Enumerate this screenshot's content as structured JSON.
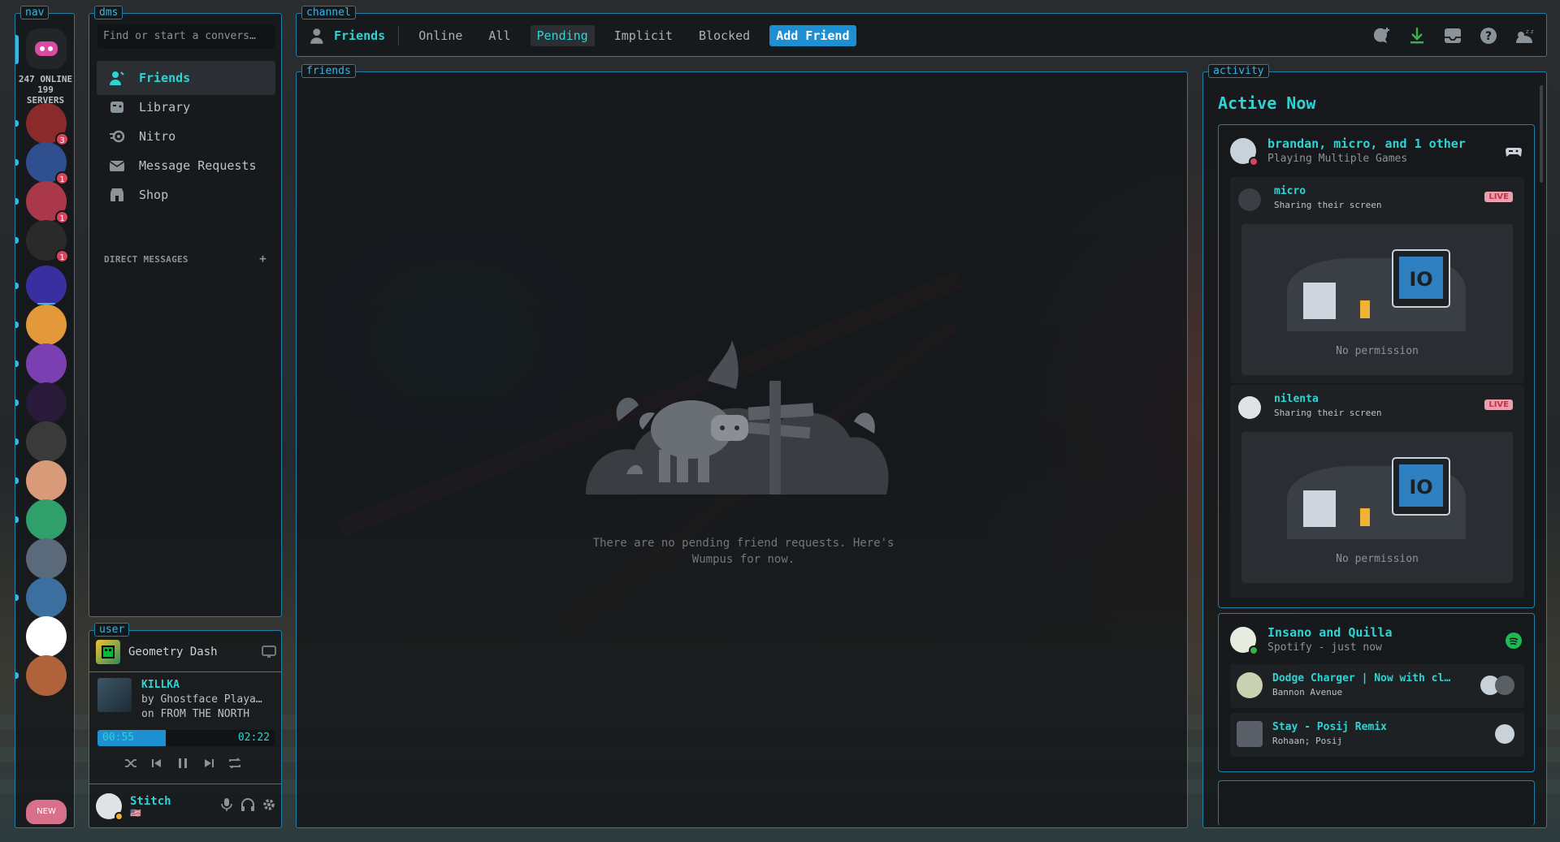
{
  "panels": {
    "nav": "nav",
    "dms": "dms",
    "user": "user",
    "channel": "channel",
    "friends": "friends",
    "activity": "activity"
  },
  "nav": {
    "online_stats": "247 ONLINE\n199\nSERVERS",
    "servers": [
      {
        "badge": "3"
      },
      {
        "badge": "1"
      },
      {
        "badge": "1"
      },
      {
        "badge": "1"
      },
      {
        "badge": ""
      },
      {
        "badge": ""
      },
      {
        "badge": ""
      },
      {
        "badge": ""
      },
      {
        "badge": ""
      },
      {
        "badge": ""
      },
      {
        "badge": ""
      },
      {
        "badge": ""
      },
      {
        "badge": ""
      },
      {
        "badge": ""
      },
      {
        "badge": ""
      }
    ],
    "new_label": "NEW"
  },
  "dms": {
    "search_placeholder": "Find or start a convers…",
    "items": [
      {
        "label": "Friends",
        "icon": "person-wave-icon"
      },
      {
        "label": "Library",
        "icon": "library-icon"
      },
      {
        "label": "Nitro",
        "icon": "nitro-icon"
      },
      {
        "label": "Message Requests",
        "icon": "envelope-icon"
      },
      {
        "label": "Shop",
        "icon": "shop-icon"
      }
    ],
    "direct_messages_header": "DIRECT MESSAGES",
    "add_dm": "+"
  },
  "user": {
    "game": "Geometry Dash",
    "track": {
      "title": "KILLKA",
      "by": "by Ghostface Playa…",
      "on": "on FROM THE NORTH",
      "elapsed": "00:55",
      "duration": "02:22",
      "progress_fraction": 0.387
    },
    "account": {
      "name": "Stitch",
      "sub": "🇺🇸"
    }
  },
  "channel": {
    "title": "Friends",
    "tabs": [
      {
        "label": "Online",
        "active": false
      },
      {
        "label": "All",
        "active": false
      },
      {
        "label": "Pending",
        "active": true
      },
      {
        "label": "Implicit",
        "active": false
      },
      {
        "label": "Blocked",
        "active": false
      }
    ],
    "add_friend": "Add Friend"
  },
  "friends": {
    "empty_text": "There are no pending friend requests. Here's Wumpus for now."
  },
  "activity": {
    "title": "Active Now",
    "card1": {
      "title": "brandan, micro, and 1 other",
      "sub": "Playing Multiple Games",
      "streams": [
        {
          "name": "micro",
          "sub": "Sharing their screen",
          "live": "LIVE",
          "preview": "No permission"
        },
        {
          "name": "nilenta",
          "sub": "Sharing their screen",
          "live": "LIVE",
          "preview": "No permission"
        }
      ]
    },
    "card2": {
      "title": "Insano and Quilla",
      "sub": "Spotify - just now",
      "tracks": [
        {
          "title": "Dodge Charger | Now with cl…",
          "sub": "Bannon Avenue"
        },
        {
          "title": "Stay - Posij Remix",
          "sub": "Rohaan; Posij"
        }
      ]
    }
  },
  "colors": {
    "accent": "#2fd3d3",
    "border": "#1f7fa8",
    "button": "#1e8fd1",
    "badge": "#d9445b"
  }
}
